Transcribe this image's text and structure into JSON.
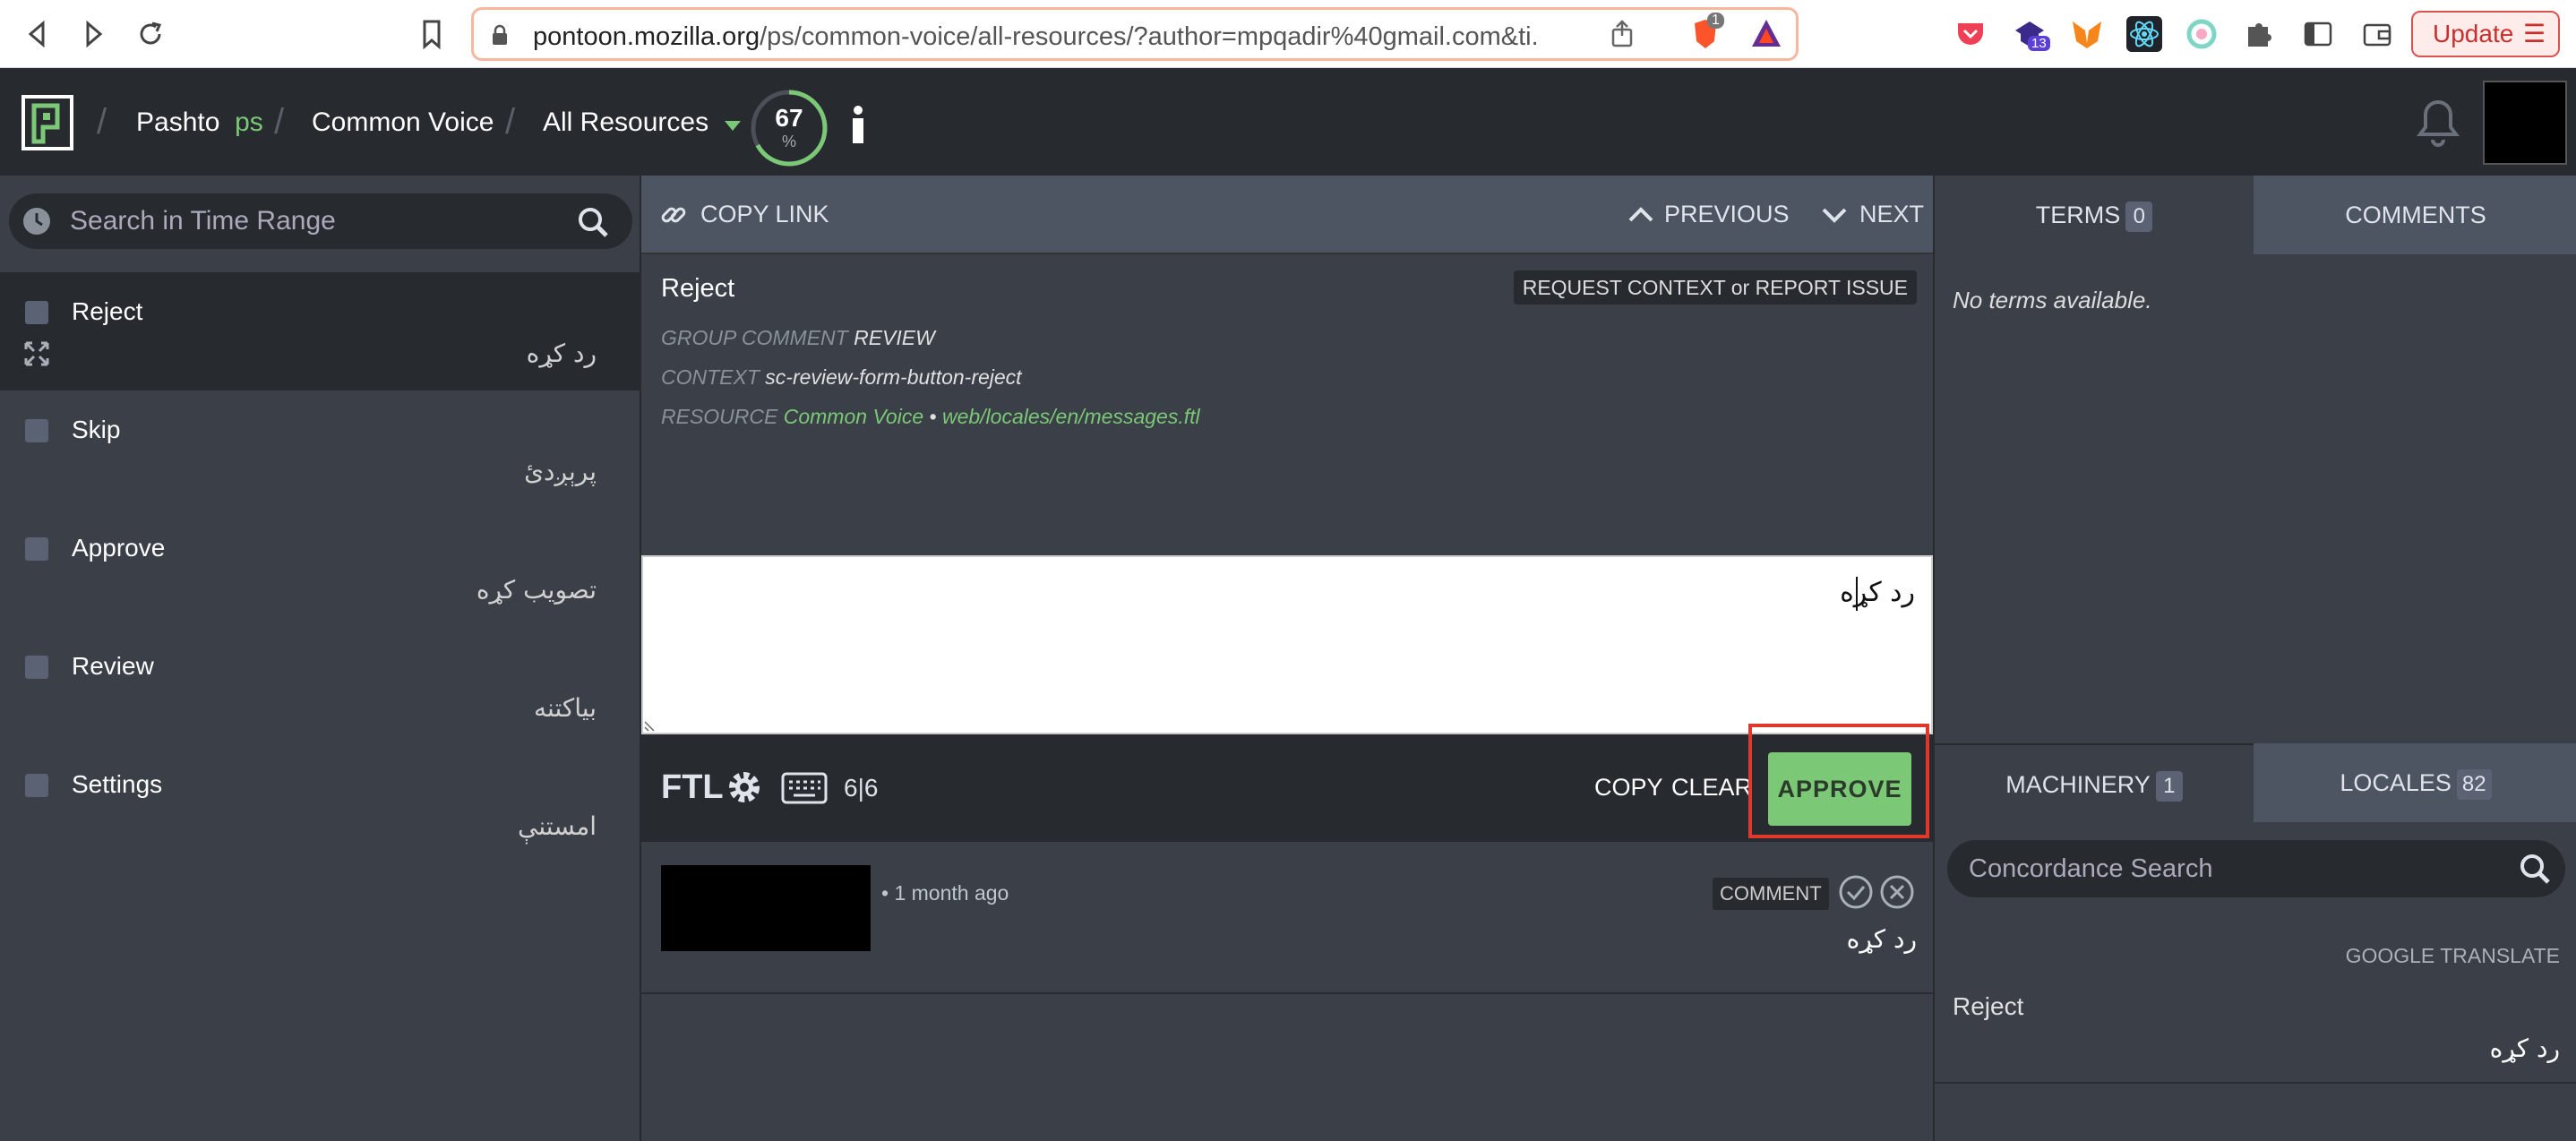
{
  "browser": {
    "url_host": "pontoon.mozilla.org",
    "url_path": "/ps/common-voice/all-resources/?author=mpqadir%40gmail.com&ti...",
    "brave_badge": "1",
    "ext_badge": "13",
    "update_label": "Update",
    "colors": {
      "url_border": "#f5b89f",
      "update": "#c9302c"
    }
  },
  "header": {
    "locale_name": "Pashto",
    "locale_code": "ps",
    "project": "Common Voice",
    "resource": "All Resources",
    "progress_value": "67",
    "progress_unit": "%",
    "progress_fraction": 0.67,
    "colors": {
      "accent": "#7bc876",
      "bg": "#272a2f"
    }
  },
  "sidebar": {
    "search_placeholder": "Search in Time Range",
    "entries": [
      {
        "source": "Reject",
        "translation": "رد کړه",
        "selected": true
      },
      {
        "source": "Skip",
        "translation": "پرېږدئ",
        "selected": false
      },
      {
        "source": "Approve",
        "translation": "تصويب کړه",
        "selected": false
      },
      {
        "source": "Review",
        "translation": "بیاکتنه",
        "selected": false
      },
      {
        "source": "Settings",
        "translation": "امستنې",
        "selected": false
      }
    ]
  },
  "editor": {
    "copy_link": "COPY LINK",
    "previous": "PREVIOUS",
    "next": "NEXT",
    "source_title": "Reject",
    "request_context": "REQUEST CONTEXT or REPORT ISSUE",
    "meta": {
      "group_comment_key": "GROUP COMMENT",
      "group_comment_value": "REVIEW",
      "context_key": "CONTEXT",
      "context_value": "sc-review-form-button-reject",
      "resource_key": "RESOURCE",
      "resource_project": "Common Voice",
      "resource_sep": "•",
      "resource_path": "web/locales/en/messages.ftl"
    },
    "translation_text": "رد کړه",
    "toolbar": {
      "ftl": "FTL",
      "char_count": "6|6",
      "copy": "COPY",
      "clear": "CLEAR",
      "approve": "APPROVE"
    },
    "history": {
      "date": "• 1 month ago",
      "comment_label": "COMMENT",
      "translation": "رد کړه"
    }
  },
  "right_panel": {
    "terms_label": "TERMS",
    "terms_count": "0",
    "comments_label": "COMMENTS",
    "no_terms": "No terms available.",
    "machinery_label": "MACHINERY",
    "machinery_count": "1",
    "locales_label": "LOCALES",
    "locales_count": "82",
    "concordance_placeholder": "Concordance Search",
    "mt_source": "GOOGLE TRANSLATE",
    "mt_original": "Reject",
    "mt_translation": "رد کړه"
  },
  "icons": [
    "back-icon",
    "forward-icon",
    "reload-icon",
    "bookmark-icon",
    "lock-icon",
    "share-icon",
    "brave-shield-icon",
    "brave-rewards-icon",
    "pocket-icon",
    "extension-icon",
    "metamask-icon",
    "react-devtools-icon",
    "wallet-icon",
    "puzzle-icon",
    "sidebar-icon",
    "menu-icon",
    "pontoon-logo",
    "info-icon",
    "bell-icon",
    "clock-icon",
    "search-icon",
    "expand-icon",
    "link-icon",
    "chevron-up-icon",
    "chevron-down-icon",
    "gear-icon",
    "keyboard-icon",
    "check-circle-icon",
    "x-circle-icon"
  ]
}
